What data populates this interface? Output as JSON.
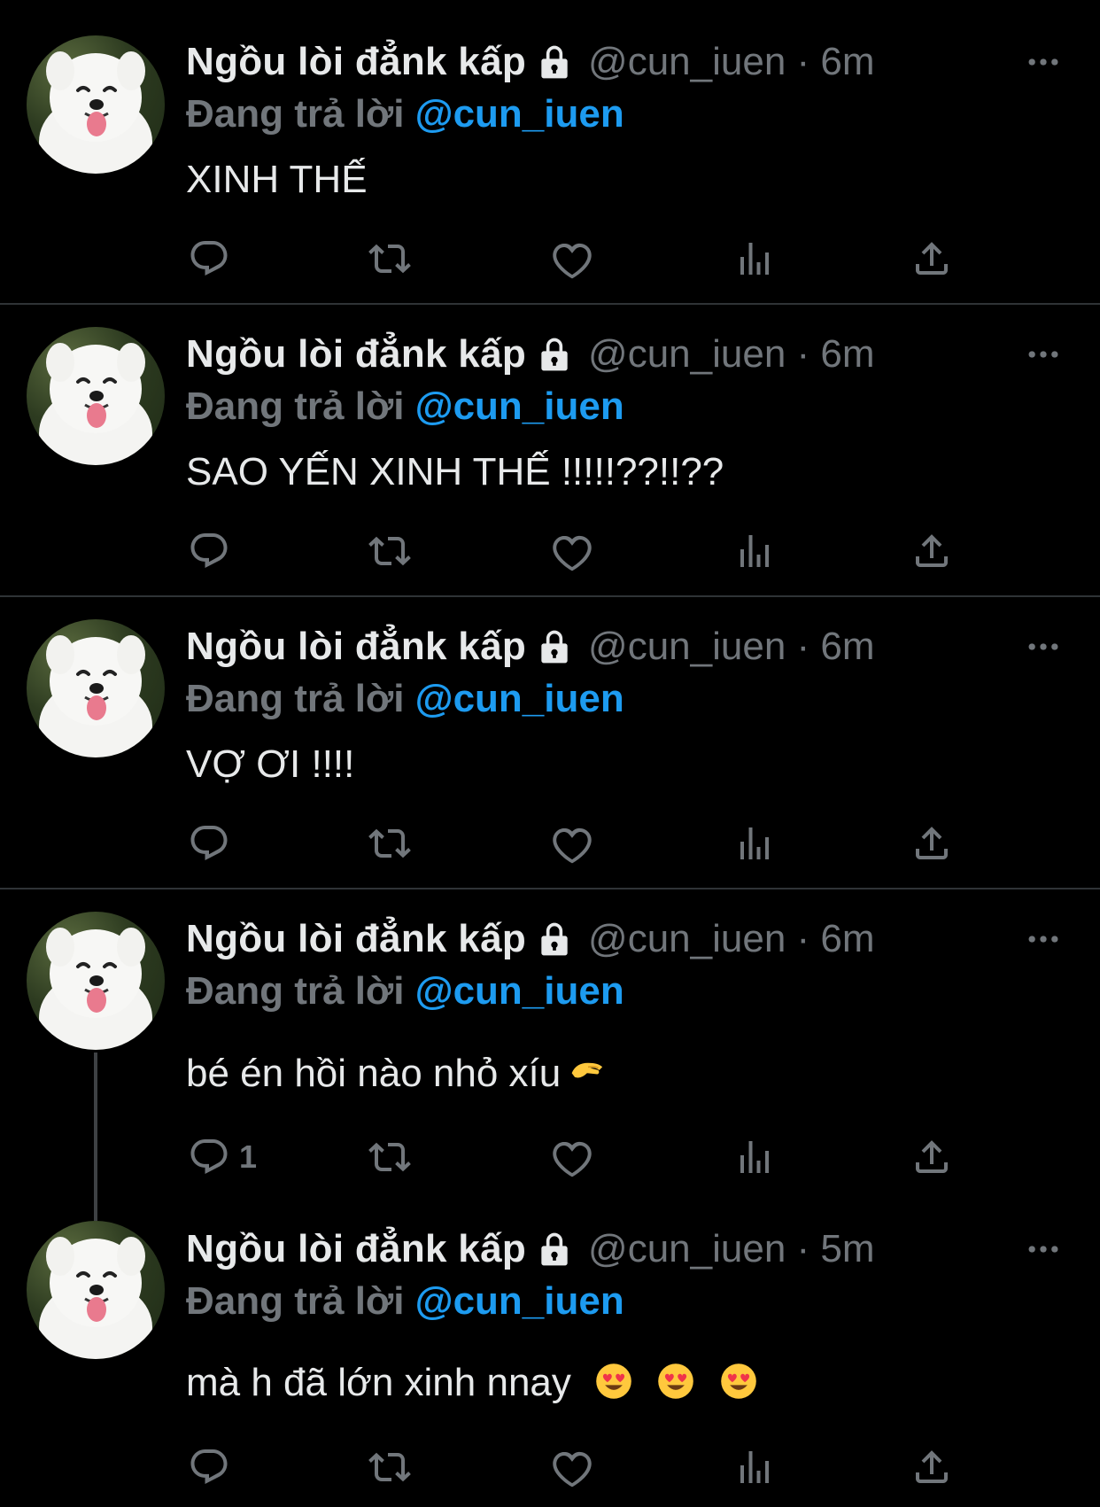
{
  "colors": {
    "background": "#000000",
    "text": "#e7e9ea",
    "muted": "#71767b",
    "accent": "#1d9bf0",
    "divider": "#2f3336"
  },
  "tweets": [
    {
      "name": "Ngồu lòi đẳnk kấp",
      "handle": "@cun_iuen · 6m",
      "replying_prefix": "Đang trả lời",
      "replying_to": "@cun_iuen",
      "text": "XINH THẾ",
      "reply_count": ""
    },
    {
      "name": "Ngồu lòi đẳnk kấp",
      "handle": "@cun_iuen · 6m",
      "replying_prefix": "Đang trả lời",
      "replying_to": "@cun_iuen",
      "text": "SAO YẾN XINH THẾ !!!!!??!!??",
      "reply_count": ""
    },
    {
      "name": "Ngồu lòi đẳnk kấp",
      "handle": "@cun_iuen · 6m",
      "replying_prefix": "Đang trả lời",
      "replying_to": "@cun_iuen",
      "text": "VỢ ƠI !!!!",
      "reply_count": ""
    },
    {
      "name": "Ngồu lòi đẳnk kấp",
      "handle": "@cun_iuen · 6m",
      "replying_prefix": "Đang trả lời",
      "replying_to": "@cun_iuen",
      "text": "bé én hồi nào nhỏ xíu",
      "reply_count": "1",
      "emoji": "pinching-hand-emoji"
    },
    {
      "name": "Ngồu lòi đẳnk kấp",
      "handle": "@cun_iuen · 5m",
      "replying_prefix": "Đang trả lời",
      "replying_to": "@cun_iuen",
      "text": "mà h đã lớn xinh nnay",
      "reply_count": "",
      "emoji": "heart-eyes-emoji x3"
    }
  ],
  "icons": {
    "lock": "lock-icon",
    "more": "more-icon",
    "reply": "reply-icon",
    "retweet": "retweet-icon",
    "like": "heart-icon",
    "views": "views-icon",
    "share": "share-icon"
  }
}
